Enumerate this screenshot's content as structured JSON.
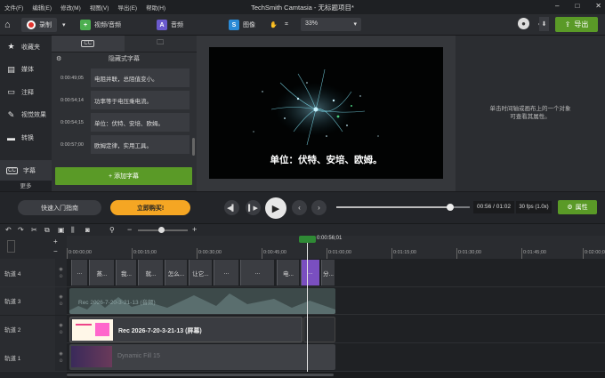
{
  "menu": [
    "文件(F)",
    "编辑(E)",
    "修改(M)",
    "视图(V)",
    "导出(E)",
    "帮助(H)"
  ],
  "app_title": "TechSmith Camtasia - 无标题项目*",
  "toolbar": {
    "record_label": "录制",
    "tabs": [
      {
        "label": "视频/音频",
        "icon": "video-audio-icon",
        "color": "#4caf50"
      },
      {
        "label": "音频",
        "icon": "audio-icon",
        "color": "#6a5acd"
      },
      {
        "label": "图像",
        "icon": "image-icon",
        "color": "#2a8ad6"
      }
    ],
    "zoom": "33%",
    "export_label": "导出"
  },
  "sidebar": {
    "items": [
      {
        "label": "收藏夹",
        "icon": "star-icon",
        "glyph": "★"
      },
      {
        "label": "媒体",
        "icon": "media-icon",
        "glyph": "▤"
      },
      {
        "label": "注释",
        "icon": "annotation-icon",
        "glyph": "▭"
      },
      {
        "label": "视觉效果",
        "icon": "visual-effects-icon",
        "glyph": "✎"
      },
      {
        "label": "转换",
        "icon": "transition-icon",
        "glyph": "▬"
      },
      {
        "label": "字幕",
        "icon": "captions-icon",
        "glyph": "CC"
      }
    ],
    "more_label": "更多"
  },
  "captions_panel": {
    "tab_cc": "CC",
    "header": "隐藏式字幕",
    "rows": [
      {
        "time": "0:00:49;05",
        "text": "电阻并联，总阻值变小。"
      },
      {
        "time": "0:00:54;14",
        "text": "功率等于电压乘电流。"
      },
      {
        "time": "0:00:54;15",
        "text": "单位：伏特、安培、欧姆。"
      },
      {
        "time": "0:00:57;00",
        "text": "欧姆定律，实用工具。"
      }
    ],
    "add_label": "+ 添加字幕"
  },
  "canvas": {
    "subtitle": "单位：伏特、安培、欧姆。"
  },
  "properties": {
    "empty_text": "单击时间轴或画布上的一个对象\n可查看其属性。"
  },
  "playback": {
    "guide_label": "快速入门指南",
    "buy_label": "立即购买!",
    "time": "00:56 / 01:02",
    "fps": "30 fps (1.0x)",
    "props_label": "属性",
    "progress": 0.85
  },
  "timeline": {
    "playhead_time": "0:00:56;01",
    "ruler_ticks": [
      "0:00:00;00",
      "0:00:15;00",
      "0:00:30;00",
      "0:00:45;00",
      "0:01:00;00",
      "0:01:15;00",
      "0:01:30;00",
      "0:01:45;00",
      "0:02:00;00"
    ],
    "tracks": [
      {
        "name": "轨道 4"
      },
      {
        "name": "轨道 3",
        "clip": "Rec 2026-7-20-3-21-13 (音频)"
      },
      {
        "name": "轨道 2",
        "clip": "Rec 2026-7-20-3-21-13 (屏幕)"
      },
      {
        "name": "轨道 1",
        "clip": "Dynamic Fill 15"
      }
    ],
    "caption_clips": [
      "...",
      "蒸...",
      "我...",
      "就...",
      "怎么...",
      "让它...",
      "...",
      "...",
      "电...",
      "...",
      "分..."
    ]
  },
  "colors": {
    "accent": "#5a9a27",
    "buy": "#f5a623",
    "playhead": "#2f8a35"
  }
}
